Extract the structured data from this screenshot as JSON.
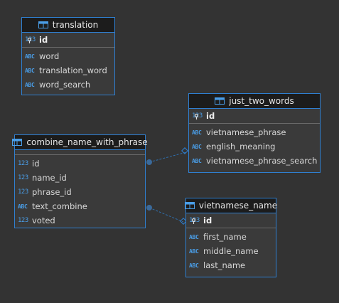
{
  "colors": {
    "background": "#333333",
    "border": "#2f7fd0",
    "header": "#1c1c1c",
    "type_icon": "#4a9ee8"
  },
  "type_labels": {
    "numeric": "123",
    "text": "ABC"
  },
  "tables": {
    "translation": {
      "name": "translation",
      "pk": {
        "type": "123",
        "name": "id"
      },
      "columns": [
        {
          "type": "ABC",
          "name": "word"
        },
        {
          "type": "ABC",
          "name": "translation_word"
        },
        {
          "type": "ABC",
          "name": "word_search"
        }
      ]
    },
    "just_two_words": {
      "name": "just_two_words",
      "pk": {
        "type": "123",
        "name": "id"
      },
      "columns": [
        {
          "type": "ABC",
          "name": "vietnamese_phrase"
        },
        {
          "type": "ABC",
          "name": "english_meaning"
        },
        {
          "type": "ABC",
          "name": "vietnamese_phrase_search"
        }
      ]
    },
    "combine_name_with_phrase": {
      "name": "combine_name_with_phrase",
      "columns": [
        {
          "type": "123",
          "name": "id"
        },
        {
          "type": "123",
          "name": "name_id"
        },
        {
          "type": "123",
          "name": "phrase_id"
        },
        {
          "type": "ABC",
          "name": "text_combine"
        },
        {
          "type": "123",
          "name": "voted"
        }
      ]
    },
    "vietnamese_name": {
      "name": "vietnamese_name",
      "pk": {
        "type": "123",
        "name": "id"
      },
      "columns": [
        {
          "type": "ABC",
          "name": "first_name"
        },
        {
          "type": "ABC",
          "name": "middle_name"
        },
        {
          "type": "ABC",
          "name": "last_name"
        }
      ]
    }
  }
}
